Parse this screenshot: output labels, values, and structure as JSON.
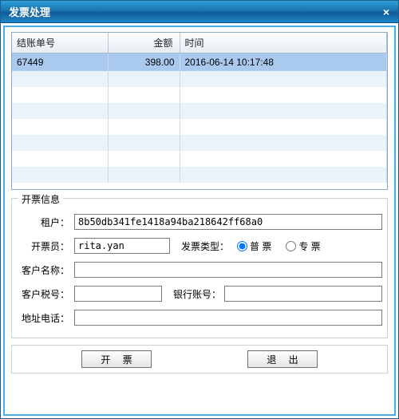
{
  "window": {
    "title": "发票处理"
  },
  "grid": {
    "headers": {
      "id": "结账单号",
      "amount": "金额",
      "time": "时间"
    },
    "rows": [
      {
        "id": "67449",
        "amount": "398.00",
        "time": "2016-06-14 10:17:48"
      },
      {
        "id": "",
        "amount": "",
        "time": ""
      },
      {
        "id": "",
        "amount": "",
        "time": ""
      },
      {
        "id": "",
        "amount": "",
        "time": ""
      },
      {
        "id": "",
        "amount": "",
        "time": ""
      },
      {
        "id": "",
        "amount": "",
        "time": ""
      },
      {
        "id": "",
        "amount": "",
        "time": ""
      },
      {
        "id": "",
        "amount": "",
        "time": ""
      }
    ]
  },
  "fieldset": {
    "legend": "开票信息",
    "tenant_label": "租户：",
    "tenant_value": "8b50db341fe1418a94ba218642ff68a0",
    "issuer_label": "开票员：",
    "issuer_value": "rita.yan",
    "invoice_type_label": "发票类型：",
    "type_normal": "普 票",
    "type_special": "专 票",
    "customer_name_label": "客户名称：",
    "customer_name_value": "",
    "customer_tax_label": "客户税号：",
    "customer_tax_value": "",
    "bank_account_label": "银行账号：",
    "bank_account_value": "",
    "address_phone_label": "地址电话：",
    "address_phone_value": ""
  },
  "buttons": {
    "issue": "开 票",
    "exit": "退 出"
  }
}
